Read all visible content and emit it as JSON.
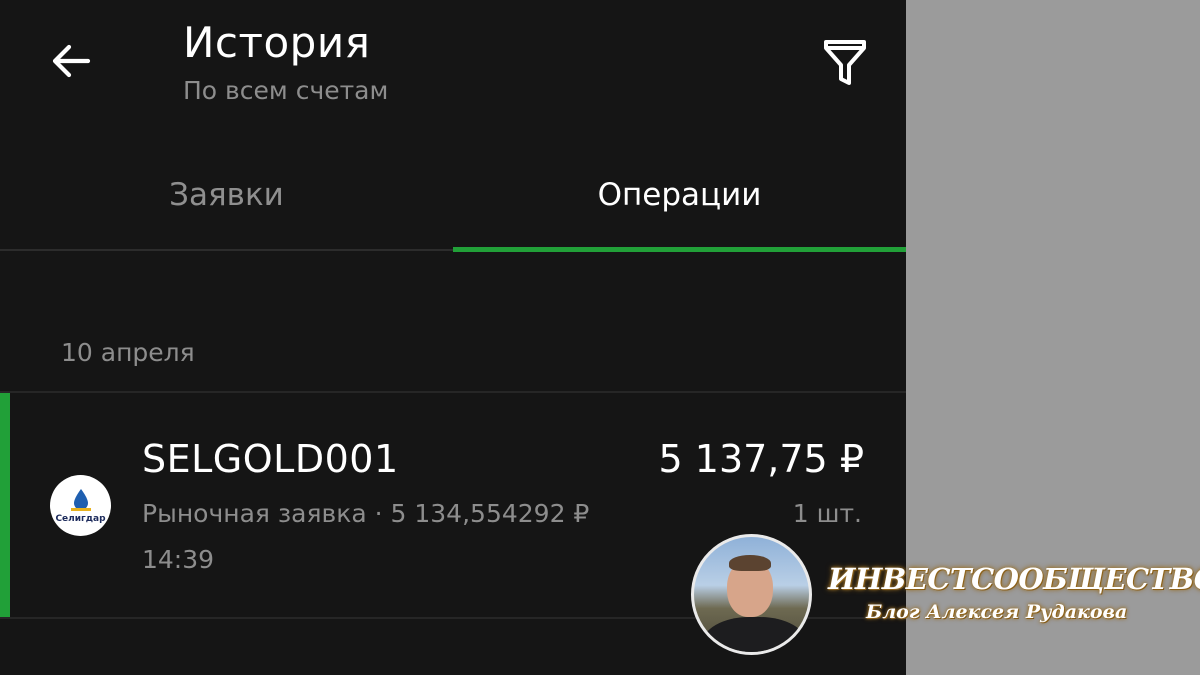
{
  "header": {
    "title": "История",
    "subtitle": "По всем счетам",
    "back_icon": "arrow-left-icon",
    "filter_icon": "filter-icon"
  },
  "tabs": [
    {
      "label": "Заявки",
      "active": false
    },
    {
      "label": "Операции",
      "active": true
    }
  ],
  "operations": {
    "date": "10 апреля",
    "items": [
      {
        "logo_text": "Селигдар",
        "name": "SELGOLD001",
        "amount": "5 137,75 ₽",
        "details": "Рыночная заявка · 5 134,554292 ₽",
        "quantity": "1 шт.",
        "time": "14:39"
      }
    ]
  },
  "watermark": {
    "brand": "ИНВЕСТСООБЩЕСТВО",
    "tagline": "Блог Алексея Рудакова"
  },
  "colors": {
    "background": "#151515",
    "accent_green": "#21a038",
    "text_primary": "#ffffff",
    "text_secondary": "#8d8d8d",
    "side_panel": "#9b9b9b"
  }
}
